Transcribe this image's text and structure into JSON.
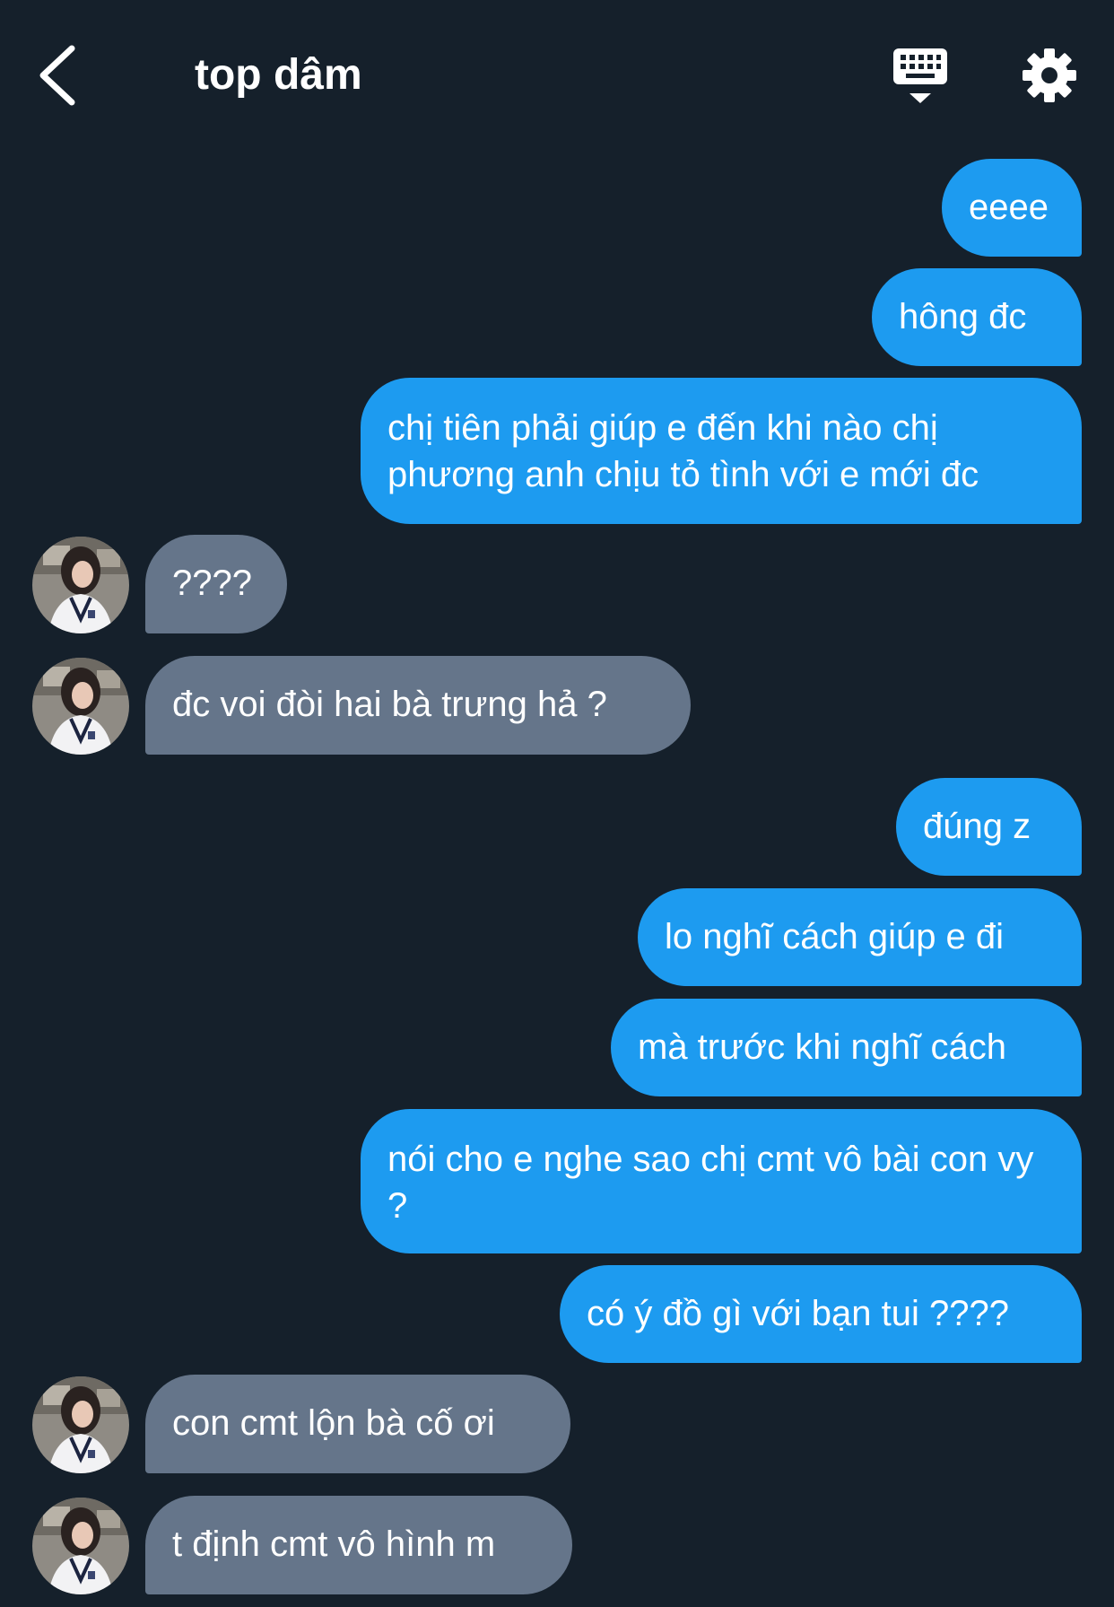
{
  "header": {
    "title": "top dâm",
    "back_icon": "chevron-left-icon",
    "keyboard_icon": "keyboard-icon",
    "settings_icon": "gear-icon"
  },
  "colors": {
    "background": "#15202b",
    "sent_bubble": "#1d9bf0",
    "received_bubble": "#65758a",
    "text": "#ffffff"
  },
  "messages": [
    {
      "direction": "sent",
      "text": "eeee"
    },
    {
      "direction": "sent",
      "text": "hông đc"
    },
    {
      "direction": "sent",
      "text": "chị tiên phải giúp e đến khi nào chị phương anh chịu tỏ tình với e mới đc"
    },
    {
      "direction": "received",
      "text": "????"
    },
    {
      "direction": "received",
      "text": "đc voi đòi hai bà trưng hả ?"
    },
    {
      "direction": "sent",
      "text": "đúng z"
    },
    {
      "direction": "sent",
      "text": "lo nghĩ cách giúp e đi"
    },
    {
      "direction": "sent",
      "text": "mà trước khi nghĩ cách"
    },
    {
      "direction": "sent",
      "text": "nói cho e nghe sao chị cmt vô bài con vy ?"
    },
    {
      "direction": "sent",
      "text": "có ý đồ gì với bạn tui ????"
    },
    {
      "direction": "received",
      "text": "con cmt lộn bà cố ơi"
    },
    {
      "direction": "received",
      "text": "t định cmt vô hình m"
    }
  ]
}
